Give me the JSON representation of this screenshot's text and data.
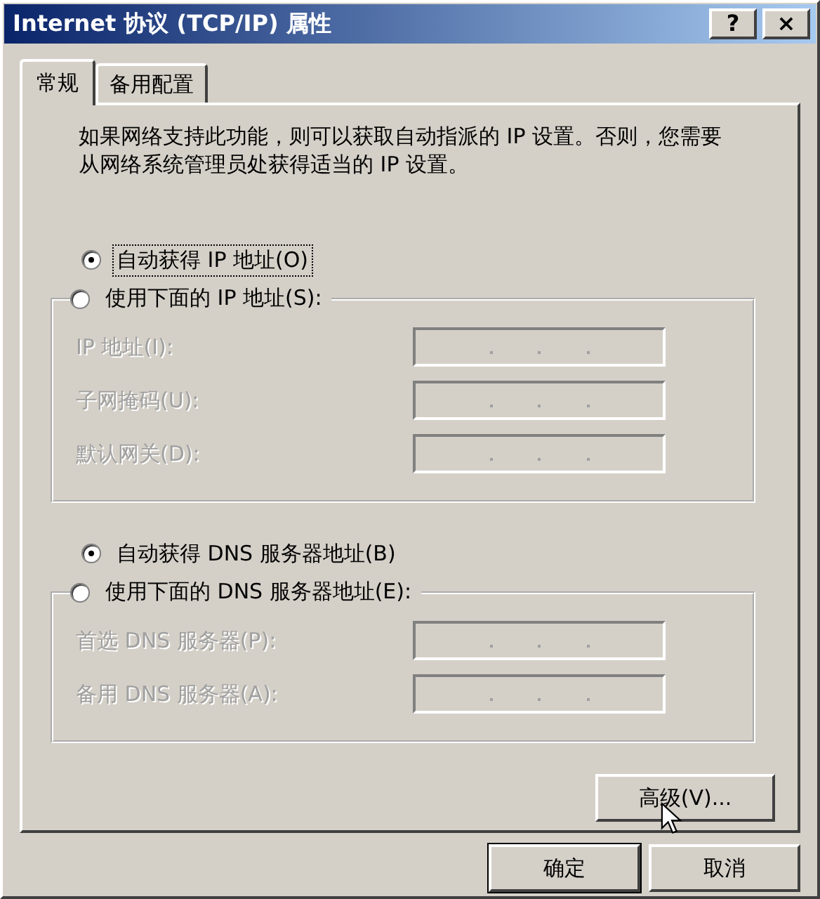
{
  "window": {
    "title": "Internet 协议 (TCP/IP) 属性",
    "help_button": "?",
    "close_button": "×"
  },
  "tabs": [
    {
      "label": "常规",
      "selected": true
    },
    {
      "label": "备用配置",
      "selected": false
    }
  ],
  "description": "如果网络支持此功能，则可以获取自动指派的 IP 设置。否则，您需要从网络系统管理员处获得适当的 IP 设置。",
  "ip_section": {
    "auto_option": {
      "label": "自动获得 IP 地址(O)",
      "selected": true,
      "focused": true
    },
    "manual_option": {
      "label": "使用下面的 IP 地址(S):",
      "selected": false
    },
    "fields": [
      {
        "label": "IP 地址(I):",
        "disabled": true
      },
      {
        "label": "子网掩码(U):",
        "disabled": true
      },
      {
        "label": "默认网关(D):",
        "disabled": true
      }
    ]
  },
  "dns_section": {
    "auto_option": {
      "label": "自动获得 DNS 服务器地址(B)",
      "selected": true,
      "focused": false
    },
    "manual_option": {
      "label": "使用下面的 DNS 服务器地址(E):",
      "selected": false
    },
    "fields": [
      {
        "label": "首选 DNS 服务器(P):",
        "disabled": true
      },
      {
        "label": "备用 DNS 服务器(A):",
        "disabled": true
      }
    ]
  },
  "advanced_button": "高级(V)...",
  "buttons": [
    {
      "label": "确定",
      "default": true
    },
    {
      "label": "取消",
      "default": false
    }
  ]
}
